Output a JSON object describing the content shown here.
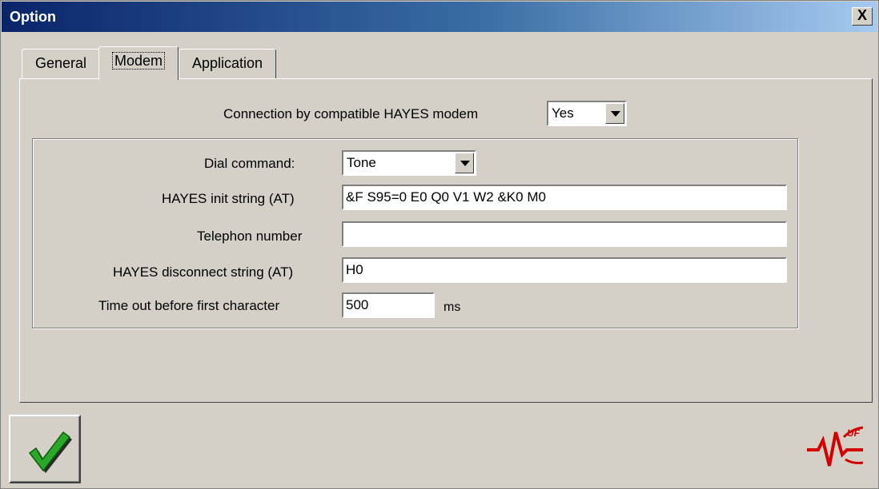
{
  "window": {
    "title": "Option",
    "close_label": "X"
  },
  "tabs": [
    {
      "label": "General",
      "active": false
    },
    {
      "label": "Modem",
      "active": true
    },
    {
      "label": "Application",
      "active": false
    }
  ],
  "modem": {
    "connection_label": "Connection by compatible HAYES modem",
    "connection_value": "Yes",
    "dial_command_label": "Dial command:",
    "dial_command_value": "Tone",
    "init_string_label": "HAYES init string (AT)",
    "init_string_value": "&F S95=0 E0 Q0 V1 W2 &K0 M0",
    "phone_label": "Telephon number",
    "phone_value": "",
    "disconnect_label": "HAYES disconnect string (AT)",
    "disconnect_value": "H0",
    "timeout_label": "Time out before first character",
    "timeout_value": "500",
    "timeout_unit": "ms"
  },
  "footer": {
    "ok_icon": "checkmark-icon",
    "logo_text": "UF"
  }
}
